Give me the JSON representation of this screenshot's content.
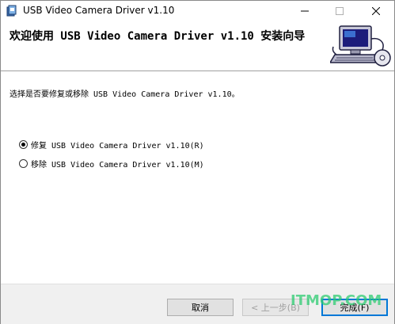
{
  "window": {
    "title": "USB Video Camera Driver v1.10",
    "icon": "installer-icon"
  },
  "titlebar_buttons": {
    "minimize": "minimize-icon",
    "maximize": "maximize-icon",
    "close": "close-icon"
  },
  "banner": {
    "title": "欢迎使用 USB Video Camera Driver v1.10 安装向导",
    "art": "computer-installer-icon"
  },
  "body": {
    "prompt": "选择是否要修复或移除 USB Video Camera Driver v1.10。"
  },
  "options": [
    {
      "label": "修复 USB Video Camera Driver v1.10(R)",
      "selected": true
    },
    {
      "label": "移除 USB Video Camera Driver v1.10(M)",
      "selected": false
    }
  ],
  "buttons": {
    "cancel": "取消",
    "back": "< 上一步(B)",
    "finish": "完成(F)"
  },
  "watermark": "ITMOP.COM",
  "colors": {
    "accent": "#0078d7",
    "footer_bg": "#f0f0f0",
    "button_bg": "#e1e1e1",
    "watermark": "#2ecc71"
  }
}
